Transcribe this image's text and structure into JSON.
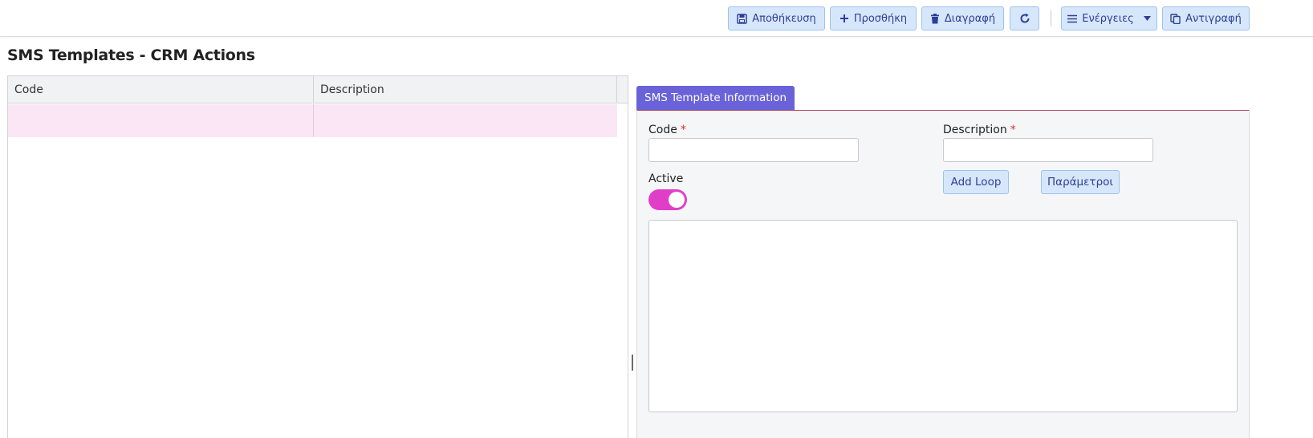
{
  "toolbar": {
    "save_label": "Αποθήκευση",
    "add_label": "Προσθήκη",
    "delete_label": "Διαγραφή",
    "actions_label": "Ενέργειες",
    "copy_label": "Αντιγραφή"
  },
  "page": {
    "title": "SMS Templates - CRM Actions"
  },
  "grid": {
    "columns": [
      "Code",
      "Description"
    ],
    "rows": [
      {
        "code": "",
        "description": ""
      }
    ]
  },
  "form": {
    "tab_label": "SMS Template Information",
    "code_label": "Code",
    "description_label": "Description",
    "required_mark": "*",
    "code_value": "",
    "description_value": "",
    "active_label": "Active",
    "active": true,
    "add_loop_label": "Add Loop",
    "parameters_label": "Παράμετροι",
    "body_value": ""
  },
  "colors": {
    "accent": "#6a62d8",
    "button_bg": "#d7e7fb",
    "button_text": "#2e3f96",
    "toggle_on": "#e13ec8",
    "selected_row": "#fbe6f6",
    "required": "#e0302e"
  },
  "icons": [
    "save-icon",
    "plus-icon",
    "trash-icon",
    "refresh-icon",
    "menu-icon",
    "caret-down-icon",
    "copy-icon"
  ]
}
